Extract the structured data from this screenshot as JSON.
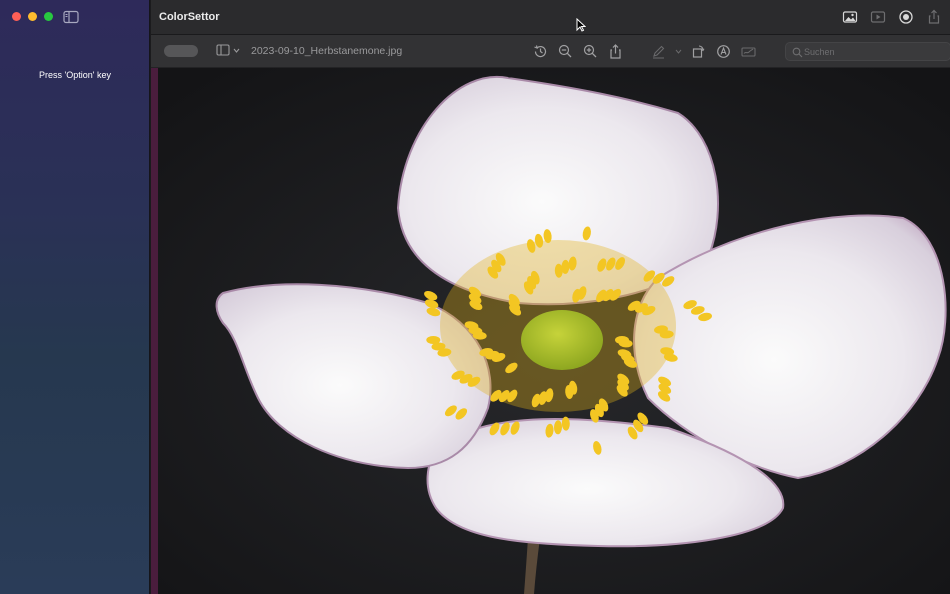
{
  "window": {
    "traffic_lights": {
      "close": "#ff5f57",
      "minimize": "#febc2e",
      "maximize": "#28c840"
    }
  },
  "sidebar": {
    "hint": "Press 'Option' key",
    "gradient": [
      "#2e2a5a",
      "#26384f",
      "#2a3c58"
    ]
  },
  "titlebar": {
    "app_title": "ColorSettor",
    "icons": [
      "photo-icon",
      "slideshow-icon",
      "record-icon",
      "share-icon"
    ]
  },
  "toolbar": {
    "filename": "2023-09-10_Herbstanemone.jpg",
    "tools": [
      "rotate-history-icon",
      "zoom-out-icon",
      "zoom-in-icon",
      "share-icon",
      "markup-pen-icon",
      "chevron-down-icon",
      "rotate-icon",
      "annotate-icon",
      "sign-icon"
    ]
  },
  "search": {
    "placeholder": "Suchen"
  },
  "content": {
    "image": "white anemone flower on dark background",
    "accent_color": "#4a1d3d"
  }
}
